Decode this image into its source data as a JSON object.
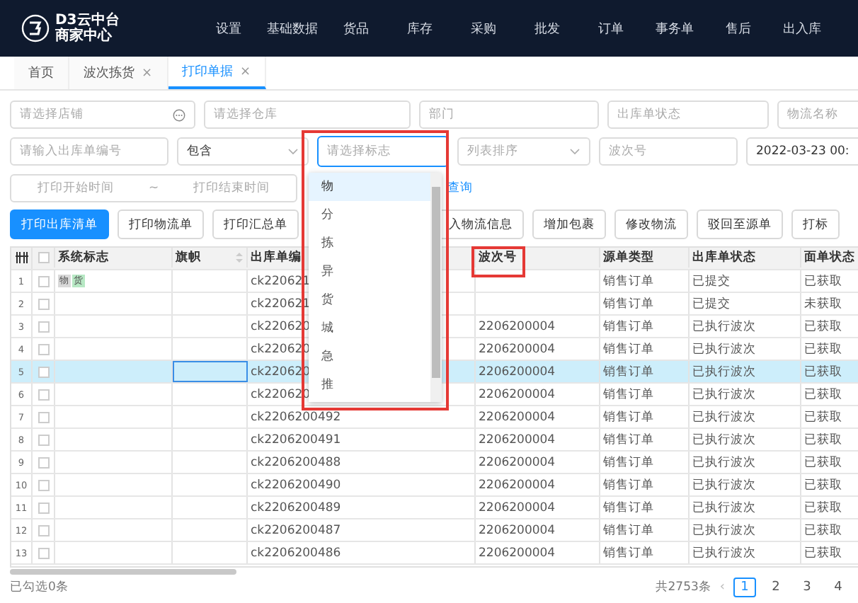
{
  "header": {
    "logo_title": "D3云中台",
    "logo_subtitle": "商家中心",
    "menu": [
      "设置",
      "基础数据",
      "货品",
      "库存",
      "采购",
      "批发",
      "订单",
      "事务单",
      "售后",
      "出入库"
    ]
  },
  "tabs": [
    {
      "label": "首页",
      "selected": false
    },
    {
      "label": "波次拣货",
      "close": "×",
      "selected": false
    },
    {
      "label": "打印单据",
      "close": "×",
      "selected": true
    }
  ],
  "filter_rows": [
    [
      {
        "kind": "input",
        "placeholder": "请选择店铺",
        "more": true,
        "focused": false
      },
      {
        "kind": "input",
        "placeholder": "请选择仓库",
        "focused": false
      },
      {
        "kind": "input",
        "placeholder": "部门",
        "focused": false
      },
      {
        "kind": "input",
        "placeholder": "出库单状态",
        "focused": false
      },
      {
        "kind": "input",
        "placeholder": "物流名称",
        "focused": false
      }
    ],
    [
      {
        "kind": "input",
        "placeholder": "请输入出库单编号",
        "focused": false
      },
      {
        "kind": "select",
        "value": "包含"
      },
      {
        "kind": "input",
        "placeholder": "请选择标志",
        "focused": true
      },
      {
        "kind": "select",
        "placeholder": "列表排序"
      },
      {
        "kind": "input",
        "placeholder": "波次号",
        "focused": false
      },
      {
        "kind": "input",
        "value": "2022-03-23 00:",
        "focused": false
      }
    ],
    [
      {
        "kind": "range",
        "start_placeholder": "打印开始时间",
        "separator": "~",
        "end_placeholder": "打印结束时间"
      },
      {
        "kind": "link",
        "label": "查询"
      }
    ]
  ],
  "buttons": [
    {
      "label": "打印出库清单",
      "primary": true
    },
    {
      "label": "打印物流单",
      "primary": false
    },
    {
      "label": "打印汇总单",
      "primary": false
    },
    {
      "label": "入物流信息",
      "primary": false
    },
    {
      "label": "增加包裹",
      "primary": false
    },
    {
      "label": "修改物流",
      "primary": false
    },
    {
      "label": "驳回至源单",
      "primary": false
    },
    {
      "label": "打标",
      "primary": false
    }
  ],
  "flag_dropdown": {
    "options": [
      {
        "label": "物",
        "selected": true
      },
      {
        "label": "分",
        "selected": false
      },
      {
        "label": "拣",
        "selected": false
      },
      {
        "label": "异",
        "selected": false
      },
      {
        "label": "货",
        "selected": false
      },
      {
        "label": "城",
        "selected": false
      },
      {
        "label": "急",
        "selected": false
      },
      {
        "label": "推",
        "selected": false
      }
    ]
  },
  "table": {
    "header_checked": false,
    "columns": [
      "系统标志",
      "旗帜",
      "出库单编",
      "波次号",
      "源单类型",
      "出库单状态",
      "面单状态"
    ],
    "rows": [
      {
        "index": "1",
        "checked": false,
        "selected": false,
        "flag_focused": false,
        "flags": [
          {
            "label": "物",
            "color": "#d9d9d9"
          },
          {
            "label": "货",
            "color": "#b7e8c4"
          }
        ],
        "order_no": "ck220621",
        "wave_no": "",
        "source_type": "销售订单",
        "out_status": "已提交",
        "waybill_status": "已获取"
      },
      {
        "index": "2",
        "checked": false,
        "selected": false,
        "flag_focused": false,
        "flags": [],
        "order_no": "ck220621",
        "wave_no": "",
        "source_type": "销售订单",
        "out_status": "已提交",
        "waybill_status": "未获取"
      },
      {
        "index": "3",
        "checked": false,
        "selected": false,
        "flag_focused": false,
        "flags": [],
        "order_no": "ck220620",
        "wave_no": "2206200004",
        "source_type": "销售订单",
        "out_status": "已执行波次",
        "waybill_status": "已获取"
      },
      {
        "index": "4",
        "checked": false,
        "selected": false,
        "flag_focused": false,
        "flags": [],
        "order_no": "ck220620",
        "wave_no": "2206200004",
        "source_type": "销售订单",
        "out_status": "已执行波次",
        "waybill_status": "已获取"
      },
      {
        "index": "5",
        "checked": false,
        "selected": true,
        "flag_focused": true,
        "flags": [],
        "order_no": "ck220620",
        "wave_no": "2206200004",
        "source_type": "销售订单",
        "out_status": "已执行波次",
        "waybill_status": "已获取"
      },
      {
        "index": "6",
        "checked": false,
        "selected": false,
        "flag_focused": false,
        "flags": [],
        "order_no": "ck220620",
        "wave_no": "2206200004",
        "source_type": "销售订单",
        "out_status": "已执行波次",
        "waybill_status": "已获取"
      },
      {
        "index": "7",
        "checked": false,
        "selected": false,
        "flag_focused": false,
        "flags": [],
        "order_no": "ck2206200492",
        "wave_no": "2206200004",
        "source_type": "销售订单",
        "out_status": "已执行波次",
        "waybill_status": "已获取"
      },
      {
        "index": "8",
        "checked": false,
        "selected": false,
        "flag_focused": false,
        "flags": [],
        "order_no": "ck2206200491",
        "wave_no": "2206200004",
        "source_type": "销售订单",
        "out_status": "已执行波次",
        "waybill_status": "已获取"
      },
      {
        "index": "9",
        "checked": false,
        "selected": false,
        "flag_focused": false,
        "flags": [],
        "order_no": "ck2206200488",
        "wave_no": "2206200004",
        "source_type": "销售订单",
        "out_status": "已执行波次",
        "waybill_status": "已获取"
      },
      {
        "index": "10",
        "checked": false,
        "selected": false,
        "flag_focused": false,
        "flags": [],
        "order_no": "ck2206200490",
        "wave_no": "2206200004",
        "source_type": "销售订单",
        "out_status": "已执行波次",
        "waybill_status": "已获取"
      },
      {
        "index": "11",
        "checked": false,
        "selected": false,
        "flag_focused": false,
        "flags": [],
        "order_no": "ck2206200489",
        "wave_no": "2206200004",
        "source_type": "销售订单",
        "out_status": "已执行波次",
        "waybill_status": "已获取"
      },
      {
        "index": "12",
        "checked": false,
        "selected": false,
        "flag_focused": false,
        "flags": [],
        "order_no": "ck2206200487",
        "wave_no": "2206200004",
        "source_type": "销售订单",
        "out_status": "已执行波次",
        "waybill_status": "已获取"
      },
      {
        "index": "13",
        "checked": false,
        "selected": false,
        "flag_focused": false,
        "flags": [],
        "order_no": "ck2206200486",
        "wave_no": "2206200004",
        "source_type": "销售订单",
        "out_status": "已执行波次",
        "waybill_status": "已获取"
      }
    ]
  },
  "footer": {
    "selected_count": "已勾选0条",
    "total": "共2753条",
    "prev": "‹",
    "pages": [
      {
        "label": "1",
        "selected": true
      },
      {
        "label": "2",
        "selected": false
      },
      {
        "label": "3",
        "selected": false
      },
      {
        "label": "4",
        "selected": false
      }
    ]
  }
}
